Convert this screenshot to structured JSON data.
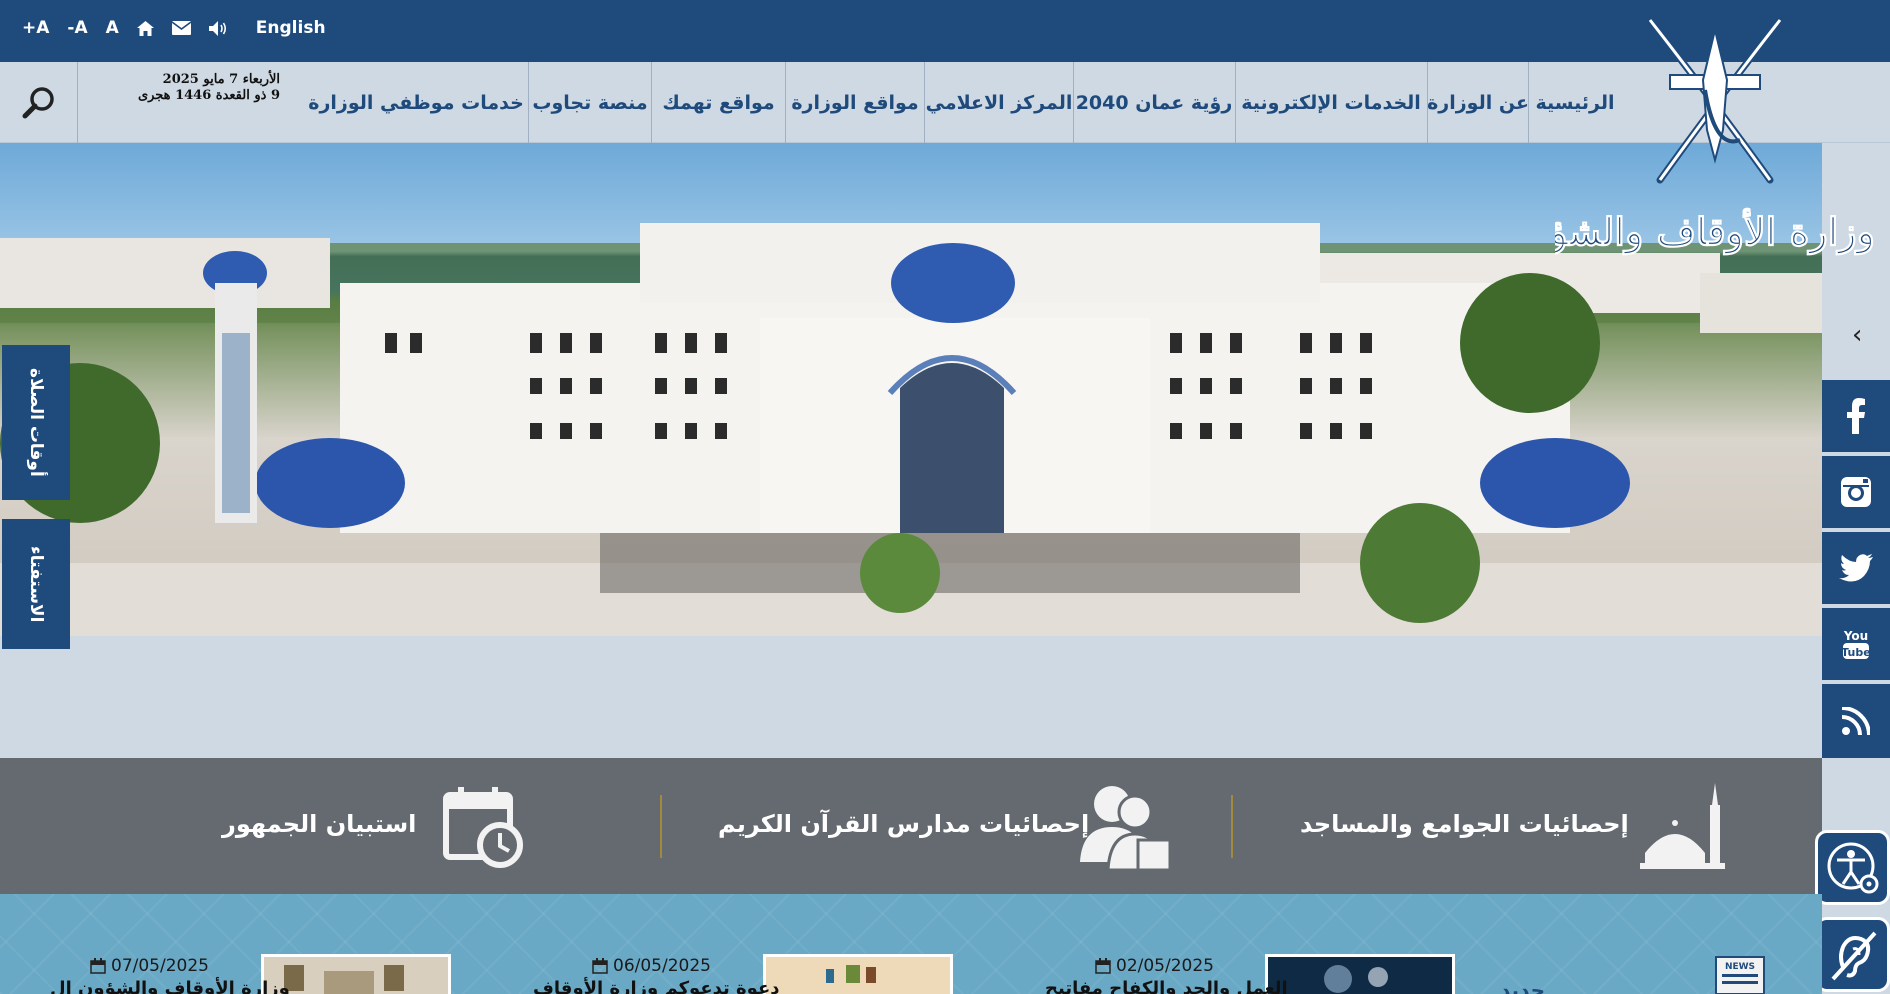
{
  "accessibility_bar": {
    "increase_font": "+A",
    "decrease_font": "-A",
    "reset_font": "A",
    "language": "English"
  },
  "date": {
    "gregorian": "الأربعاء 7 مايو 2025",
    "hijri": "9 ذو القعدة 1446 هجرى"
  },
  "nav": {
    "items": [
      "الرئيسية",
      "عن الوزارة",
      "الخدمات الإلكترونية",
      "رؤية عمان 2040",
      "المركز الاعلامي",
      "مواقع الوزارة",
      "مواقع تهمك",
      "منصة تجاوب",
      "خدمات موظفي الوزارة"
    ]
  },
  "logo": {
    "text": "وزارة الأوقاف والشؤون الدينية"
  },
  "side_tabs": {
    "prayer_times": "أوقات الصلاة",
    "fatwa": "الاستفتاء"
  },
  "social": [
    "facebook-icon",
    "instagram-icon",
    "twitter-icon",
    "youtube-icon",
    "rss-icon"
  ],
  "stats": {
    "mosques": "إحصائيات الجوامع والمساجد",
    "quran_schools": "إحصائيات مدارس القرآن الكريم",
    "survey": "استبيان الجمهور"
  },
  "news": {
    "section": "جديد",
    "items": [
      {
        "date": "02/05/2025",
        "title": "العمل والجد والكفاح مفاتيح"
      },
      {
        "date": "06/05/2025",
        "title": "دعوة تدعوكم وزارة الأوقاف"
      },
      {
        "date": "07/05/2025",
        "title": "وزارة الأوقاف والشؤون ال"
      }
    ]
  },
  "colors": {
    "primary": "#1f4a7c",
    "light_bg": "#cfd9e3",
    "stats_bg": "#646a70",
    "news_bg": "#6aa9c6",
    "gold": "#a18a3b"
  }
}
